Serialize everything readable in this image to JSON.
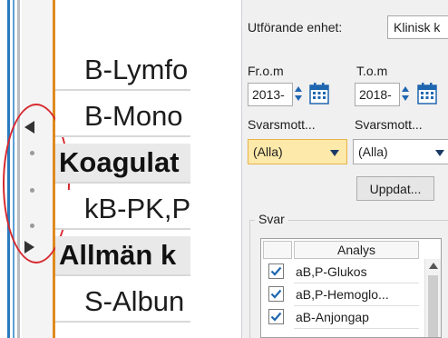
{
  "left_panel": {
    "rows": [
      {
        "text": "B-Lymfo",
        "kind": "item"
      },
      {
        "text": "B-Mono",
        "kind": "item"
      },
      {
        "text": "Koagulat",
        "kind": "group"
      },
      {
        "text": "kB-PK,P",
        "kind": "item"
      },
      {
        "text": "Allmän k",
        "kind": "group"
      },
      {
        "text": "S-Albun",
        "kind": "item"
      }
    ],
    "splitter": {
      "collapse_icon": "triangle-left-icon",
      "expand_icon": "triangle-right-icon",
      "grip_icon": "grip-dots-icon"
    },
    "highlight_color": "#d6282e"
  },
  "right_panel": {
    "utforande_enhet": {
      "label": "Utförande enhet:",
      "value": "Klinisk k"
    },
    "from": {
      "label": "Fr.o.m",
      "value": "2013-"
    },
    "to": {
      "label": "T.o.m",
      "value": "2018-"
    },
    "svarsmottagare_1": {
      "label": "Svarsmott...",
      "value": "(Alla)"
    },
    "svarsmottagare_2": {
      "label": "Svarsmott...",
      "value": "(Alla)"
    },
    "update_button": "Uppdat...",
    "svar_group": {
      "title": "Svar",
      "column_header": "Analys",
      "rows": [
        {
          "checked": true,
          "text": "aB,P-Glukos"
        },
        {
          "checked": true,
          "text": "aB,P-Hemoglo..."
        },
        {
          "checked": true,
          "text": "aB-Anjongap"
        }
      ]
    },
    "colors": {
      "highlight_select": "#fde9a9",
      "accent_blue": "#1f66b0"
    }
  }
}
